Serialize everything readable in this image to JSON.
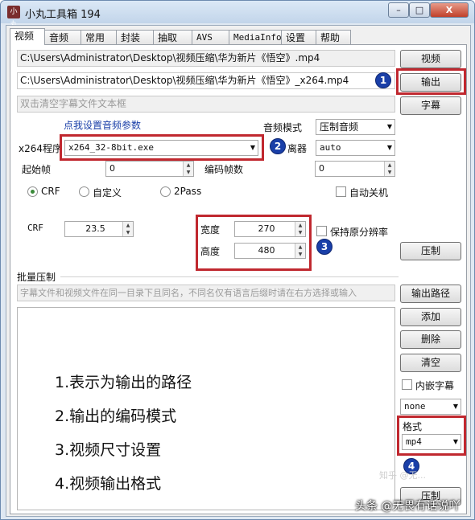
{
  "window": {
    "app_icon": "小丸",
    "title": "小丸工具箱 194",
    "minimize": "–",
    "maximize": "□",
    "close": "X"
  },
  "tabs": [
    "视频",
    "音频",
    "常用",
    "封装",
    "抽取",
    "AVS",
    "MediaInfo",
    "设置",
    "帮助"
  ],
  "files": {
    "input_path": "C:\\Users\\Administrator\\Desktop\\视频压缩\\华为新片《悟空》.mp4",
    "output_path": "C:\\Users\\Administrator\\Desktop\\视频压缩\\华为新片《悟空》_x264.mp4",
    "subtitle_placeholder": "双击清空字幕文件文本框",
    "video_button": "视频",
    "output_button": "输出",
    "subtitle_button": "字幕"
  },
  "encoder": {
    "audio_link": "点我设置音频参数",
    "audio_mode_label": "音频模式",
    "audio_mode_value": "压制音频",
    "program_label": "x264程序",
    "program_value": "x264_32-8bit.exe",
    "splitter_label": "离器",
    "splitter_value": "auto",
    "start_frame_label": "起始帧",
    "start_frame_value": "0",
    "frame_count_label": "编码帧数",
    "frame_count_value": "0",
    "mode_crf": "CRF",
    "mode_custom": "自定义",
    "mode_2pass": "2Pass",
    "auto_shutdown": "自动关机",
    "crf_label": "CRF",
    "crf_value": "23.5",
    "width_label": "宽度",
    "width_value": "270",
    "height_label": "高度",
    "height_value": "480",
    "keep_resolution": "保持原分辨率",
    "encode_button": "压制"
  },
  "batch": {
    "group_title": "批量压制",
    "hint": "字幕文件和视频文件在同一目录下且同名，不同名仅有语言后缀时请在右方选择或输入",
    "output_path_button": "输出路径",
    "add_button": "添加",
    "delete_button": "删除",
    "clear_button": "清空",
    "embed_subtitle": "内嵌字幕",
    "subtitle_lang_value": "none",
    "format_label": "格式",
    "format_value": "mp4",
    "encode_button": "压制",
    "notes": [
      "1.表示为输出的路径",
      "2.输出的编码模式",
      "3.视频尺寸设置",
      "4.视频输出格式"
    ]
  },
  "annotations": {
    "badges": [
      "1",
      "2",
      "3",
      "4"
    ],
    "color": "#c0282f",
    "badge_color": "#1a3fa8"
  },
  "watermark": {
    "text": "头条 @无畏有话说吖",
    "faint": "知乎 @无..."
  }
}
